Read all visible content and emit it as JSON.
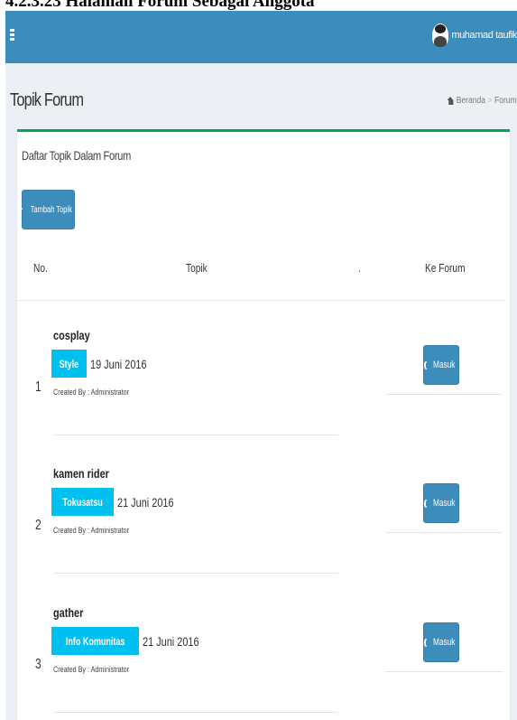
{
  "caption": "4.2.3.23 Halaman Forum Sebagai Anggota",
  "user": {
    "name": "muhamad taufik"
  },
  "header": {
    "title": "Topik Forum",
    "breadcrumb": [
      "Beranda",
      "Forum"
    ],
    "breadcrumb_separator": ">"
  },
  "box": {
    "title": "Daftar Topik Dalam Forum",
    "add_button": "Tambah Topik"
  },
  "table": {
    "columns": [
      "No.",
      "Topik",
      ".",
      "Ke Forum"
    ],
    "rows": [
      {
        "no": "1",
        "topic": "cosplay",
        "category": "Style",
        "date": "19 Juni 2016",
        "creator": "Created By : Administrator",
        "action": "Masuk"
      },
      {
        "no": "2",
        "topic": "kamen rider",
        "category": "Tokusatsu",
        "date": "21 Juni 2016",
        "creator": "Created By : Administrator",
        "action": "Masuk"
      },
      {
        "no": "3",
        "topic": "gather",
        "category": "Info Komunitas",
        "date": "21 Juni 2016",
        "creator": "Created By : Administrator",
        "action": "Masuk"
      }
    ]
  },
  "colors": {
    "navbar": "#3c8dbc",
    "box_border": "#00a65a",
    "label": "#00c0ef",
    "button": "#3c8dbc"
  },
  "icons": [
    "menu-icon",
    "avatar",
    "home-icon",
    "plus-icon",
    "sign-in-icon"
  ]
}
